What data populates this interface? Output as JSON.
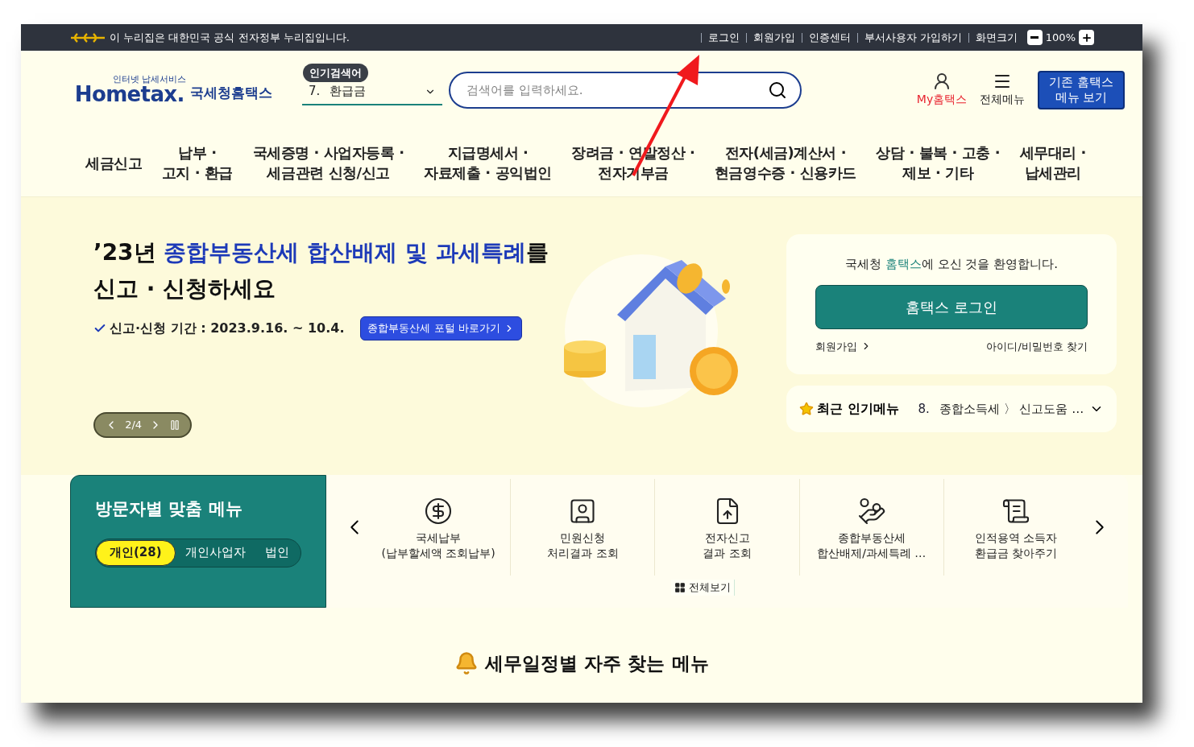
{
  "top_bar": {
    "notice": "이 누리집은 대한민국 공식 전자정부 누리집입니다.",
    "links": [
      "로그인",
      "회원가입",
      "인증센터",
      "부서사용자 가입하기"
    ],
    "zoom_label": "화면크기",
    "zoom_value": "100%"
  },
  "header": {
    "logo": {
      "tagline": "인터넷 납세서비스",
      "wordmark": "Hometax.",
      "name": "국세청홈택스"
    },
    "popular_search": {
      "label": "인기검색어",
      "rank": "7.",
      "term": "환급금"
    },
    "search": {
      "placeholder": "검색어를 입력하세요."
    },
    "my_menu": "My홈택스",
    "all_menu": "전체메뉴",
    "legacy_button": [
      "기존 홈택스",
      "메뉴 보기"
    ]
  },
  "nav": [
    {
      "lines": [
        "세금신고"
      ]
    },
    {
      "lines": [
        "납부 ·",
        "고지 · 환급"
      ]
    },
    {
      "lines": [
        "국세증명 · 사업자등록 ·",
        "세금관련 신청/신고"
      ]
    },
    {
      "lines": [
        "지급명세서 ·",
        "자료제출 · 공익법인"
      ]
    },
    {
      "lines": [
        "장려금 · 연말정산 ·",
        "전자기부금"
      ]
    },
    {
      "lines": [
        "전자(세금)계산서 ·",
        "현금영수증 · 신용카드"
      ]
    },
    {
      "lines": [
        "상담 · 불복 · 고충 ·",
        "제보 · 기타"
      ]
    },
    {
      "lines": [
        "세무대리 ·",
        "납세관리"
      ]
    }
  ],
  "banner": {
    "title": [
      {
        "text": "’23년 ",
        "highlight": false
      },
      {
        "text": "종합부동산세 합산배제 및 과세특례",
        "highlight": true
      },
      {
        "text": "를",
        "highlight": false
      }
    ],
    "title_line2": "신고 · 신청하세요",
    "period": "신고·신청 기간 : 2023.9.16. ~ 10.4.",
    "link_button": "종합부동산세 포털 바로가기",
    "pager": "2/4"
  },
  "login_card": {
    "welcome": [
      {
        "text": "국세청 ",
        "highlight": false
      },
      {
        "text": "홈택스",
        "highlight": true
      },
      {
        "text": "에 오신 것을 환영합니다.",
        "highlight": false
      }
    ],
    "login_button": "홈택스 로그인",
    "join_link": "회원가입",
    "find_link": "아이디/비밀번호 찾기"
  },
  "popular_menu": {
    "label": "최근 인기메뉴",
    "rank": "8.",
    "item": "종합소득세 〉 신고도움 …"
  },
  "visitor_menu": {
    "title": "방문자별 맞춤 메뉴",
    "tabs": [
      {
        "label": "개인(28)",
        "selected": true
      },
      {
        "label": "개인사업자",
        "selected": false
      },
      {
        "label": "법인",
        "selected": false
      }
    ]
  },
  "quick_menu": {
    "items": [
      {
        "lines": [
          "국세납부",
          "(납부할세액 조회납부)"
        ]
      },
      {
        "lines": [
          "민원신청",
          "처리결과 조회"
        ]
      },
      {
        "lines": [
          "전자신고",
          "결과 조회"
        ]
      },
      {
        "lines": [
          "종합부동산세",
          "합산배제/과세특례 …"
        ]
      },
      {
        "lines": [
          "인적용역 소득자",
          "환급금 찾아주기"
        ]
      }
    ],
    "view_all": "전체보기"
  },
  "section_title": "세무일정별 자주 찾는 메뉴"
}
